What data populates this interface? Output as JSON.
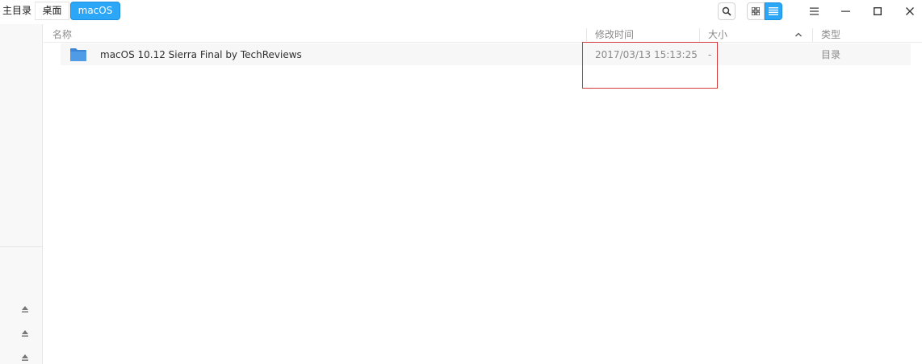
{
  "breadcrumb": {
    "items": [
      "主目录",
      "桌面",
      "macOS"
    ]
  },
  "toolbar": {
    "search_icon": "search-icon",
    "view_modes": [
      "icon-view",
      "list-view"
    ],
    "active_view": "list-view",
    "accent_color": "#2ca7f8"
  },
  "window_controls": [
    "menu",
    "minimize",
    "maximize",
    "close"
  ],
  "columns": {
    "name": "名称",
    "modified": "修改时间",
    "size": "大小",
    "type": "类型",
    "sort_column": "size",
    "sort_direction": "ascending"
  },
  "files": [
    {
      "name": "macOS 10.12 Sierra Final by TechReviews",
      "modified": "2017/03/13 15:13:25",
      "size": "-",
      "type": "目录",
      "icon": "folder-icon"
    }
  ],
  "sidebar": {
    "devices": [
      "eject-icon",
      "eject-icon",
      "eject-icon"
    ]
  },
  "annotation": {
    "highlight_color": "#d33b3b"
  }
}
